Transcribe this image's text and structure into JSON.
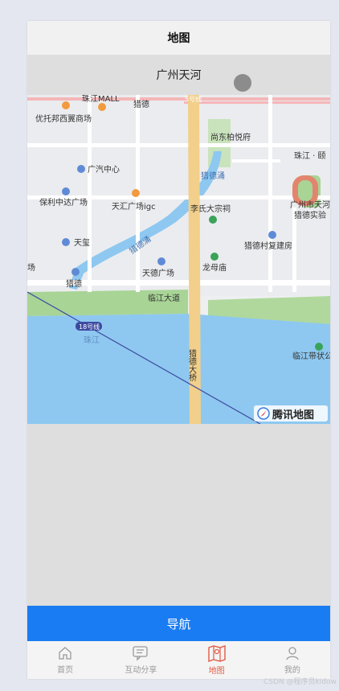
{
  "navbar": {
    "title": "地图"
  },
  "location": {
    "name": "广州天河"
  },
  "map": {
    "labels": {
      "zhujiang_mall": "珠江MALL",
      "liede_top": "猎德",
      "metro_5": "5号线",
      "youtuo": "优托邦西翼商场",
      "shangdong": "尚东柏悦府",
      "zhujiang_yi": "珠江 · 颐",
      "guangqi": "广汽中心",
      "liedeyong": "猎德涌",
      "baoli": "保利中达广场",
      "tianhui": "天汇广场igc",
      "lishi": "李氏大宗祠",
      "tianhe_school": "广州市天河",
      "liede_school": "猎德实验",
      "tianqi": "天玺",
      "liede_yong2": "猎德涌",
      "liede_village": "猎德村复建房",
      "chang": "场",
      "tiande": "天德广场",
      "longmu": "龙母庙",
      "liede_bottom": "猎德",
      "linjiang": "临江大道",
      "metro_18": "18号线",
      "zhujiang_river": "珠江",
      "bridge": "猎德大桥",
      "linjiang_belt": "临江带状公",
      "tencent": "腾讯地图"
    }
  },
  "action": {
    "navigate_label": "导航"
  },
  "tabbar": {
    "items": [
      {
        "label": "首页",
        "icon": "home-icon"
      },
      {
        "label": "互动分享",
        "icon": "chat-icon"
      },
      {
        "label": "地图",
        "icon": "map-icon",
        "active": true
      },
      {
        "label": "我的",
        "icon": "user-icon"
      }
    ]
  },
  "watermark": "CSDN @程序员kidow",
  "colors": {
    "accent_blue": "#1a7cf2",
    "active_tab": "#e25b45",
    "river": "#8ec8f0",
    "main_road": "#f2cf8a"
  }
}
